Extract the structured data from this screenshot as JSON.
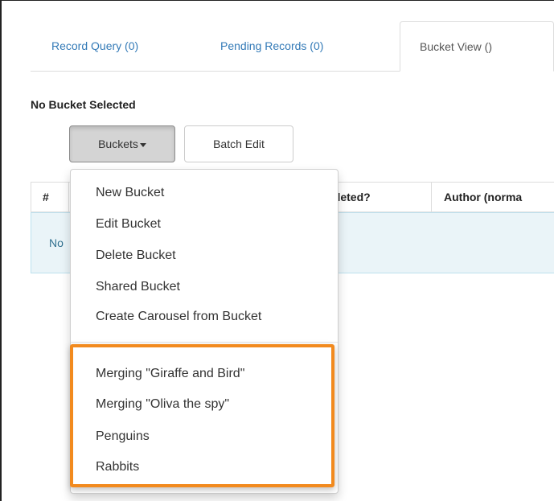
{
  "tabs": [
    {
      "label": "Record Query (0)"
    },
    {
      "label": "Pending Records (0)"
    },
    {
      "label": "Bucket View ()"
    }
  ],
  "bucket_status": "No Bucket Selected",
  "toolbar": {
    "buckets_label": "Buckets",
    "batch_edit_label": "Batch Edit"
  },
  "table": {
    "columns": [
      "#",
      "...eleted?",
      "Author (norma"
    ],
    "empty_text": "No"
  },
  "bucket_menu": {
    "actions": [
      "New Bucket",
      "Edit Bucket",
      "Delete Bucket",
      "Shared Bucket",
      "Create Carousel from Bucket"
    ],
    "buckets": [
      "Merging \"Giraffe and Bird\"",
      "Merging \"Oliva the spy\"",
      "Penguins",
      "Rabbits"
    ]
  },
  "colors": {
    "link": "#337ab7",
    "highlight": "#f28a1e",
    "empty_row_bg": "#eaf4f8"
  }
}
